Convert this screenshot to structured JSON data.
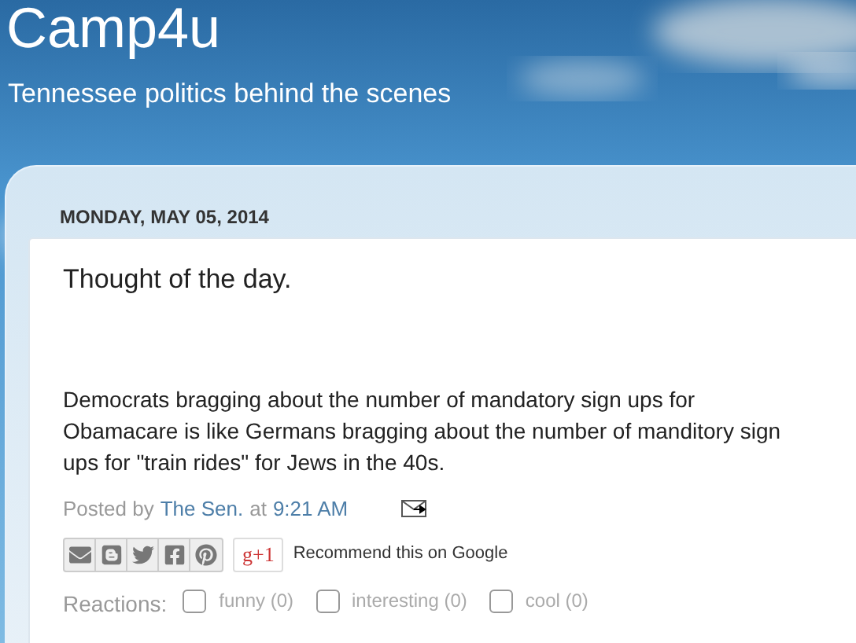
{
  "blog": {
    "title": "Camp4u",
    "description": "Tennessee politics behind the scenes"
  },
  "date_header": "MONDAY, MAY 05, 2014",
  "post": {
    "title": "Thought of the day.",
    "body_lines": [
      "Democrats bragging about the number of mandatory sign ups for",
      "Obamacare is like Germans bragging about the number of manditory sign",
      "ups for \"train rides\" for Jews in the 40s."
    ],
    "posted_by": "Posted by",
    "author": "The Sen.",
    "at": "at",
    "time": "9:21 AM",
    "share": [
      {
        "kind": "email"
      },
      {
        "kind": "blog"
      },
      {
        "kind": "twitter"
      },
      {
        "kind": "facebook"
      },
      {
        "kind": "pinterest"
      }
    ],
    "plusone": {
      "label": "g+1",
      "text": "Recommend this on Google"
    },
    "reactions_label": "Reactions:",
    "reactions": [
      {
        "label": "funny (0)",
        "checked": false
      },
      {
        "label": "interesting (0)",
        "checked": false
      },
      {
        "label": "cool (0)",
        "checked": false
      }
    ]
  }
}
